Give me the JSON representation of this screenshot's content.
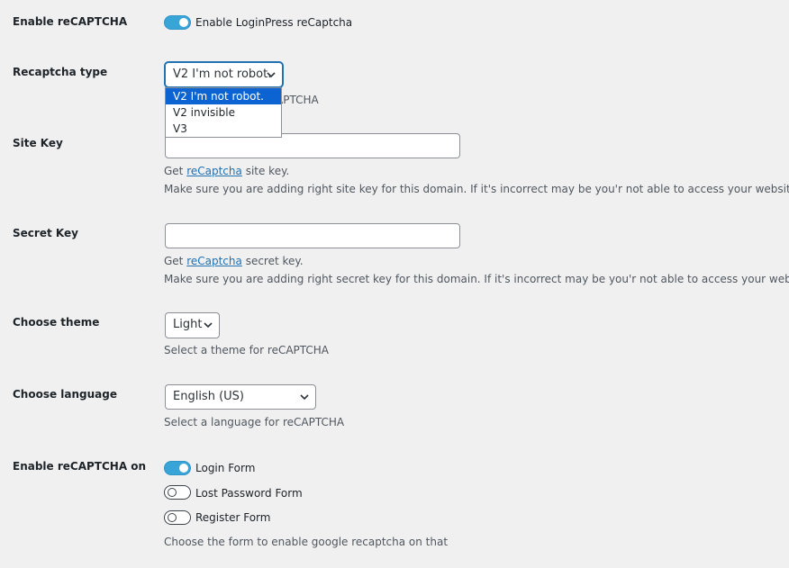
{
  "enable_recaptcha": {
    "label": "Enable reCAPTCHA",
    "toggle_text": "Enable LoginPress reCaptcha",
    "enabled": true
  },
  "recaptcha_type": {
    "label": "Recaptcha type",
    "selected": "V2 I'm not robot.",
    "options": [
      "V2 I'm not robot.",
      "V2 invisible",
      "V3"
    ],
    "hidden_desc_fragment": "APTCHA"
  },
  "site_key": {
    "label": "Site Key",
    "value": "",
    "desc_prefix": "Get ",
    "desc_link": "reCaptcha",
    "desc_suffix": " site key.",
    "desc_note": "Make sure you are adding right site key for this domain. If it's incorrect may be you'r not able to access your website."
  },
  "secret_key": {
    "label": "Secret Key",
    "value": "",
    "desc_prefix": "Get ",
    "desc_link": "reCaptcha",
    "desc_suffix": " secret key.",
    "desc_note": "Make sure you are adding right secret key for this domain. If it's incorrect may be you'r not able to access your website."
  },
  "theme": {
    "label": "Choose theme",
    "selected": "Light",
    "desc": "Select a theme for reCAPTCHA"
  },
  "language": {
    "label": "Choose language",
    "selected": "English (US)",
    "desc": "Select a language for reCAPTCHA"
  },
  "enable_on": {
    "label": "Enable reCAPTCHA on",
    "forms": [
      {
        "label": "Login Form",
        "enabled": true
      },
      {
        "label": "Lost Password Form",
        "enabled": false
      },
      {
        "label": "Register Form",
        "enabled": false
      }
    ],
    "desc": "Choose the form to enable google recaptcha on that"
  },
  "colors": {
    "toggle_on": "#38a4d8",
    "option_selected": "#0b64d1",
    "link": "#2271b1",
    "background": "#f0f0f1"
  }
}
